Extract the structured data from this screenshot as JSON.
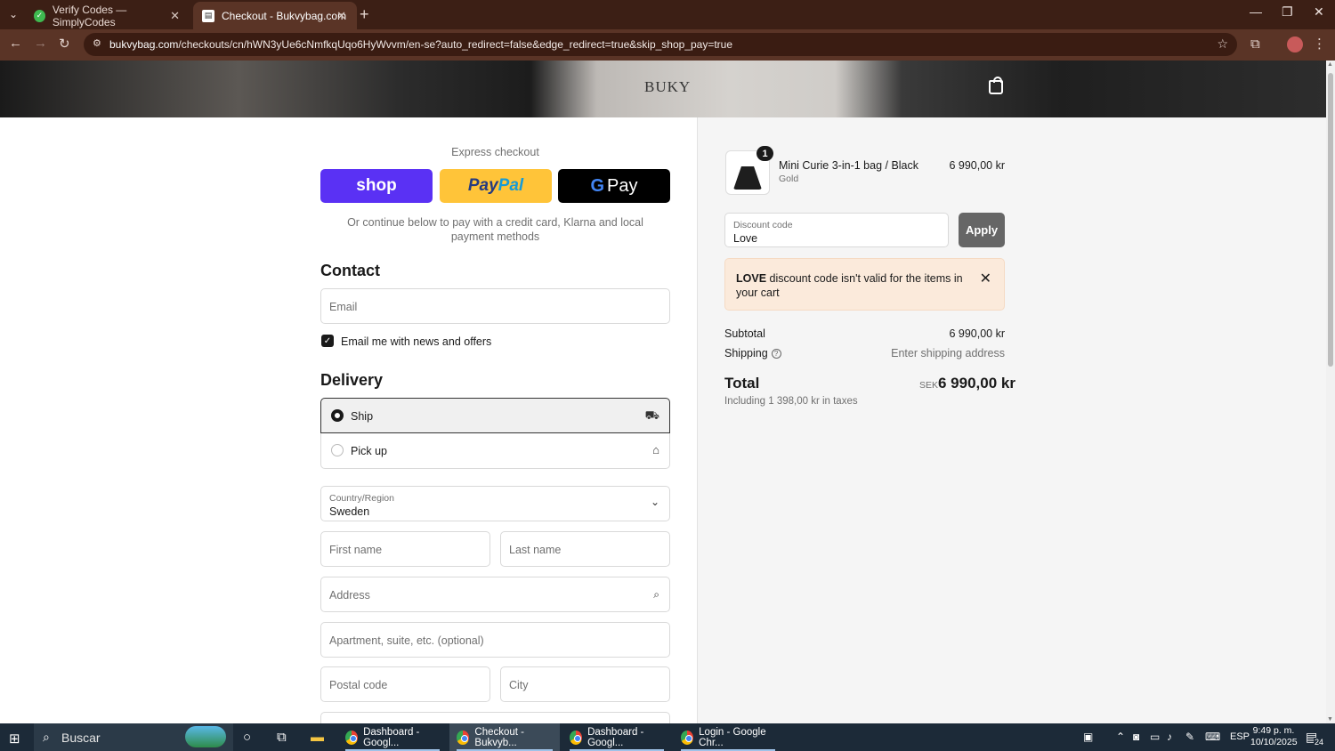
{
  "browser": {
    "tabs": [
      {
        "title": "Verify Codes — SimplyCodes",
        "icon": "simplycodes-icon"
      },
      {
        "title": "Checkout - Bukvybag.com",
        "icon": "page-icon",
        "active": true
      }
    ],
    "url_host": "bukvybag.com",
    "url_path": "/checkouts/cn/hWN3yUe6cNmfkqUqo6HyWvvm/en-se?auto_redirect=false&edge_redirect=true&skip_shop_pay=true"
  },
  "header": {
    "logo": "BUKY",
    "cart_icon": "shopping-bag-icon"
  },
  "express": {
    "label": "Express checkout",
    "shop_pay": "shop",
    "paypal_a": "Pay",
    "paypal_b": "Pal",
    "gpay_g": "G",
    "gpay_label": "Pay",
    "continue_text": "Or continue below to pay with a credit card, Klarna and local payment methods"
  },
  "contact": {
    "heading": "Contact",
    "email_placeholder": "Email",
    "newsletter_label": "Email me with news and offers",
    "newsletter_checked": true
  },
  "delivery": {
    "heading": "Delivery",
    "options": [
      {
        "label": "Ship",
        "selected": true,
        "icon": "truck-icon"
      },
      {
        "label": "Pick up",
        "selected": false,
        "icon": "store-icon"
      }
    ],
    "country_label": "Country/Region",
    "country_value": "Sweden",
    "first_name": "First name",
    "last_name": "Last name",
    "address": "Address",
    "apartment": "Apartment, suite, etc. (optional)",
    "postal_code": "Postal code",
    "city": "City"
  },
  "order": {
    "item": {
      "quantity": "1",
      "name": "Mini Curie 3-in-1 bag / Black",
      "variant": "Gold",
      "price": "6 990,00 kr"
    },
    "discount_label": "Discount code",
    "discount_value": "Love",
    "apply_label": "Apply",
    "alert_code": "LOVE",
    "alert_text": "discount code isn't valid for the items in your cart",
    "subtotal_label": "Subtotal",
    "subtotal_value": "6 990,00 kr",
    "shipping_label": "Shipping",
    "shipping_value": "Enter shipping address",
    "total_label": "Total",
    "total_currency": "SEK",
    "total_value": "6 990,00 kr",
    "taxes_text": "Including 1 398,00 kr in taxes"
  },
  "taskbar": {
    "search_label": "Buscar",
    "apps": [
      {
        "label": "Dashboard - Googl..."
      },
      {
        "label": "Checkout - Bukvyb...",
        "active": true
      },
      {
        "label": "Dashboard - Googl..."
      },
      {
        "label": "Login - Google Chr..."
      }
    ],
    "language": "ESP",
    "time": "9:49 p. m.",
    "date": "10/10/2025",
    "notification_count": "24"
  }
}
